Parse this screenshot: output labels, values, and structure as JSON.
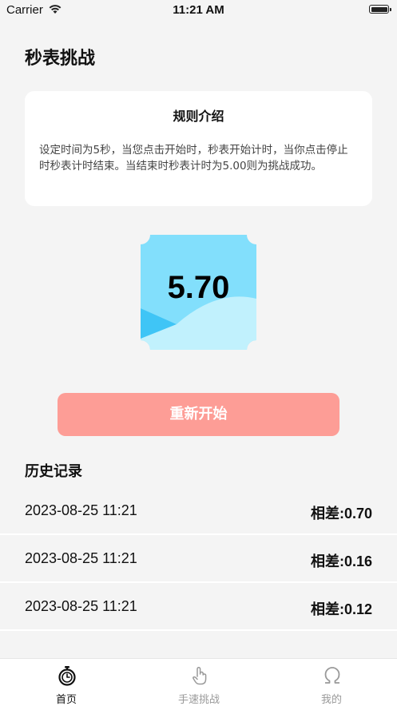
{
  "status_bar": {
    "carrier": "Carrier",
    "time": "11:21 AM"
  },
  "page": {
    "title": "秒表挑战"
  },
  "rules": {
    "title": "规则介绍",
    "text": "设定时间为5秒，当您点击开始时，秒表开始计时，当你点击停止时秒表计时结束。当结束时秒表计时为5.00则为挑战成功。"
  },
  "timer": {
    "value": "5.70"
  },
  "actions": {
    "restart_label": "重新开始"
  },
  "history": {
    "title": "历史记录",
    "rows": [
      {
        "time": "2023-08-25 11:21",
        "diff": "相差:0.70"
      },
      {
        "time": "2023-08-25 11:21",
        "diff": "相差:0.16"
      },
      {
        "time": "2023-08-25 11:21",
        "diff": "相差:0.12"
      }
    ]
  },
  "tabs": [
    {
      "label": "首页",
      "icon": "stopwatch-icon",
      "active": true
    },
    {
      "label": "手速挑战",
      "icon": "hand-pointer-icon",
      "active": false
    },
    {
      "label": "我的",
      "icon": "omega-icon",
      "active": false
    }
  ],
  "colors": {
    "accent": "#fd9d96",
    "tile_light": "#82dffc",
    "tile_wave": "#c1f1fd",
    "tile_deep": "#3fc5f6"
  }
}
